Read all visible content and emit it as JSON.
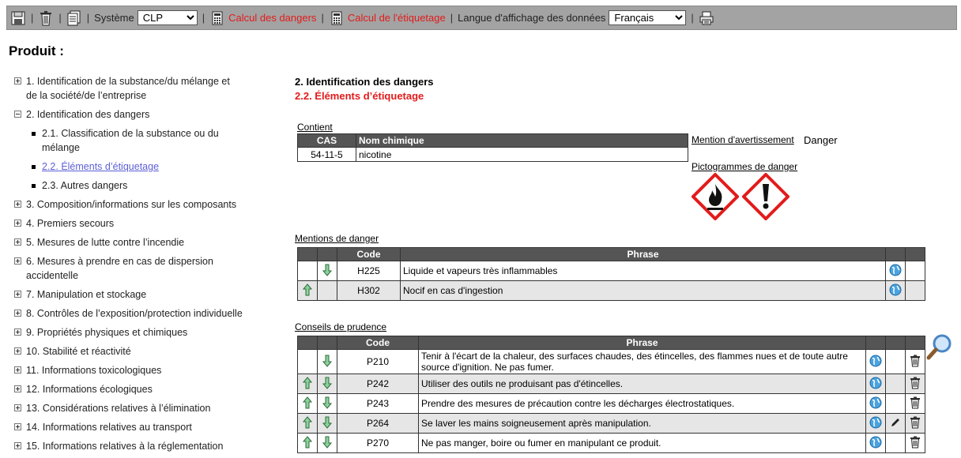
{
  "toolbar": {
    "systeme_label": "Système",
    "systeme_value": "CLP",
    "calcul_dangers": "Calcul des dangers",
    "calcul_etiquetage": "Calcul de l'étiquetage",
    "langue_label": "Langue d'affichage des données",
    "langue_value": "Français",
    "icons": [
      "save-icon",
      "trash-icon",
      "document-icon",
      "calculator-icon",
      "calculator-icon",
      "printer-icon"
    ]
  },
  "page_title": "Produit :",
  "toc": [
    {
      "label": "1. Identification de la substance/du mélange et de la société/de l’entreprise",
      "state": "plus"
    },
    {
      "label": "2. Identification des dangers",
      "state": "minus",
      "children": [
        {
          "label": "2.1. Classification de la substance ou du mélange"
        },
        {
          "label": "2.2. Éléments d’étiquetage",
          "active": true
        },
        {
          "label": "2.3. Autres dangers"
        }
      ]
    },
    {
      "label": "3. Composition/informations sur les composants",
      "state": "plus"
    },
    {
      "label": "4. Premiers secours",
      "state": "plus"
    },
    {
      "label": "5. Mesures de lutte contre l’incendie",
      "state": "plus"
    },
    {
      "label": "6. Mesures à prendre en cas de dispersion accidentelle",
      "state": "plus"
    },
    {
      "label": "7. Manipulation et stockage",
      "state": "plus"
    },
    {
      "label": "8. Contrôles de l’exposition/protection individuelle",
      "state": "plus"
    },
    {
      "label": "9. Propriétés physiques et chimiques",
      "state": "plus"
    },
    {
      "label": "10. Stabilité et réactivité",
      "state": "plus"
    },
    {
      "label": "11. Informations toxicologiques",
      "state": "plus"
    },
    {
      "label": "12. Informations écologiques",
      "state": "plus"
    },
    {
      "label": "13. Considérations relatives à l’élimination",
      "state": "plus"
    },
    {
      "label": "14. Informations relatives au transport",
      "state": "plus"
    },
    {
      "label": "15. Informations relatives à la réglementation",
      "state": "plus"
    }
  ],
  "section": {
    "title": "2. Identification des dangers",
    "subtitle": "2.2. Éléments d’étiquetage"
  },
  "contient": {
    "label": "Contient",
    "headers": [
      "CAS",
      "Nom chimique"
    ],
    "rows": [
      [
        "54-11-5",
        "nicotine"
      ]
    ]
  },
  "mention_avertissement": {
    "label": "Mention d'avertissement",
    "value": "Danger"
  },
  "pictogrammes": {
    "label": "Pictogrammes de danger",
    "items": [
      "flame-pictogram-icon",
      "exclamation-pictogram-icon"
    ]
  },
  "mentions_danger": {
    "label": "Mentions de danger",
    "headers": [
      "",
      "",
      "Code",
      "Phrase",
      "",
      ""
    ],
    "rows": [
      {
        "up": false,
        "down": true,
        "code": "H225",
        "phrase": "Liquide et vapeurs très inflammables"
      },
      {
        "up": true,
        "down": false,
        "code": "H302",
        "phrase": "Nocif en cas d'ingestion"
      }
    ]
  },
  "conseils_prudence": {
    "label": "Conseils de prudence",
    "headers": [
      "",
      "",
      "Code",
      "Phrase",
      "",
      "",
      ""
    ],
    "rows": [
      {
        "up": false,
        "down": true,
        "code": "P210",
        "phrase": "Tenir à l'écart de la chaleur, des surfaces chaudes, des étincelles, des flammes nues et de toute autre source d'ignition. Ne pas fumer.",
        "edit": false
      },
      {
        "up": true,
        "down": true,
        "code": "P242",
        "phrase": "Utiliser des outils ne produisant pas d'étincelles.",
        "edit": false
      },
      {
        "up": true,
        "down": true,
        "code": "P243",
        "phrase": "Prendre des mesures de précaution contre les décharges électrostatiques.",
        "edit": false
      },
      {
        "up": true,
        "down": true,
        "code": "P264",
        "phrase": "Se laver les mains soigneusement après manipulation.",
        "edit": true
      },
      {
        "up": true,
        "down": true,
        "code": "P270",
        "phrase": "Ne pas manger, boire ou fumer en manipulant ce produit.",
        "edit": false
      }
    ]
  }
}
